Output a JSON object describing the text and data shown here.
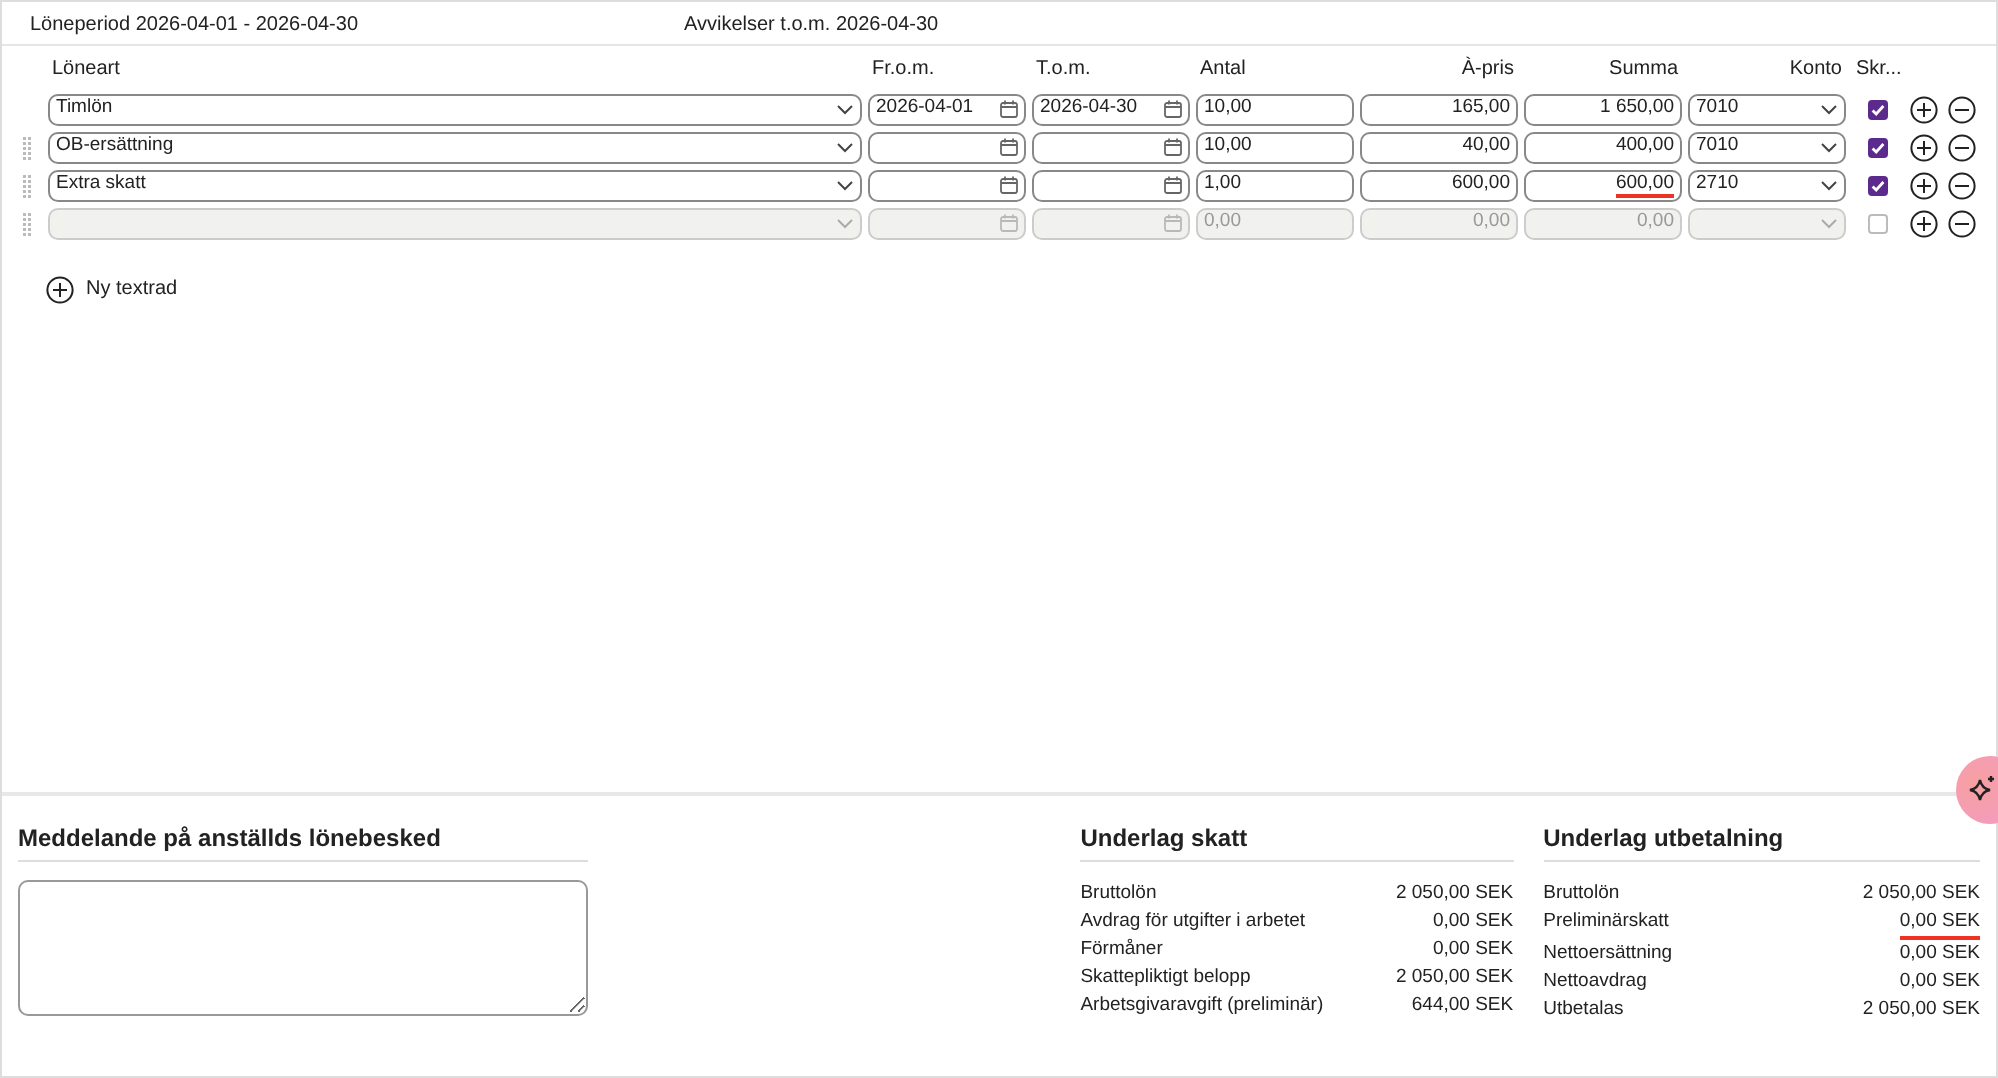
{
  "header": {
    "period": "Löneperiod 2026-04-01 - 2026-04-30",
    "deviations": "Avvikelser t.o.m. 2026-04-30"
  },
  "columns": [
    "Löneart",
    "Fr.o.m.",
    "T.o.m.",
    "Antal",
    "À-pris",
    "Summa",
    "Konto",
    "Skr..."
  ],
  "rows": [
    {
      "draggable": false,
      "disabled": false,
      "type": "Timlön",
      "from": "2026-04-01",
      "to": "2026-04-30",
      "quantity": "10,00",
      "price": "165,00",
      "sum": "1 650,00",
      "sum_underlined": false,
      "account": "7010",
      "checked": true
    },
    {
      "draggable": true,
      "disabled": false,
      "type": "OB-ersättning",
      "from": "",
      "to": "",
      "quantity": "10,00",
      "price": "40,00",
      "sum": "400,00",
      "sum_underlined": false,
      "account": "7010",
      "checked": true
    },
    {
      "draggable": true,
      "disabled": false,
      "type": "Extra skatt",
      "from": "",
      "to": "",
      "quantity": "1,00",
      "price": "600,00",
      "sum": "600,00",
      "sum_underlined": true,
      "account": "2710",
      "checked": true
    },
    {
      "draggable": true,
      "disabled": true,
      "type": "",
      "from": "",
      "to": "",
      "quantity": "0,00",
      "price": "0,00",
      "sum": "0,00",
      "sum_underlined": false,
      "account": "",
      "checked": false
    }
  ],
  "add_text_row": "Ny textrad",
  "message": {
    "title": "Meddelande på anställds lönebesked"
  },
  "tax_basis": {
    "title": "Underlag skatt",
    "rows": [
      {
        "label": "Bruttolön",
        "value": "2 050,00 SEK",
        "underlined": false
      },
      {
        "label": "Avdrag för utgifter i arbetet",
        "value": "0,00 SEK",
        "underlined": false
      },
      {
        "label": "Förmåner",
        "value": "0,00 SEK",
        "underlined": false
      },
      {
        "label": "Skattepliktigt belopp",
        "value": "2 050,00 SEK",
        "underlined": false
      },
      {
        "label": "Arbetsgivaravgift (preliminär)",
        "value": "644,00 SEK",
        "underlined": false
      }
    ]
  },
  "payout_basis": {
    "title": "Underlag utbetalning",
    "rows": [
      {
        "label": "Bruttolön",
        "value": "2 050,00 SEK",
        "underlined": false
      },
      {
        "label": "Preliminärskatt",
        "value": "0,00 SEK",
        "underlined": true
      },
      {
        "label": "Nettoersättning",
        "value": "0,00 SEK",
        "underlined": false
      },
      {
        "label": "Nettoavdrag",
        "value": "0,00 SEK",
        "underlined": false
      },
      {
        "label": "Utbetalas",
        "value": "2 050,00 SEK",
        "underlined": false
      }
    ]
  }
}
